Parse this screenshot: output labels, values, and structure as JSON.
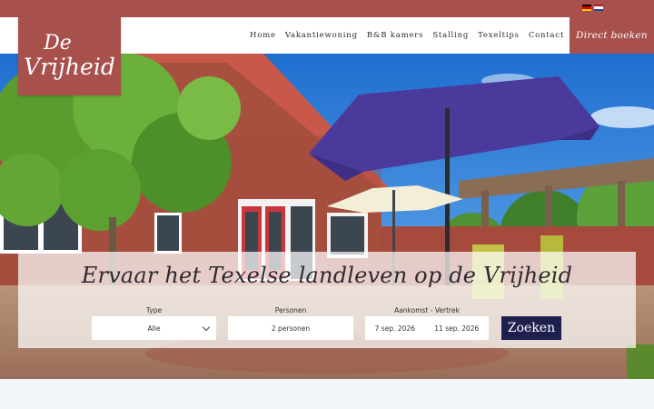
{
  "brand": {
    "line1": "De",
    "line2": "Vrijheid"
  },
  "languages": [
    {
      "name": "flag-de-icon",
      "colors": [
        "#000000",
        "#dd0000",
        "#ffce00"
      ]
    },
    {
      "name": "flag-nl-icon",
      "colors": [
        "#ae1c28",
        "#ffffff",
        "#21468b"
      ]
    }
  ],
  "nav": {
    "items": [
      "Home",
      "Vakantiewoning",
      "B&B kamers",
      "Stalling",
      "Texeltips",
      "Contact"
    ],
    "cta": "Direct boeken"
  },
  "hero": {
    "headline": "Ervaar het Texelse landleven op de Vrijheid"
  },
  "search": {
    "type_label": "Type",
    "type_value": "Alle",
    "persons_label": "Personen",
    "persons_value": "2 personen",
    "dates_label": "Aankomst - Vertrek",
    "arrival": "7 sep. 2026",
    "departure": "11 sep. 2026",
    "button": "Zoeken"
  },
  "colors": {
    "brand": "#a8504c",
    "button": "#1e1f4e"
  }
}
